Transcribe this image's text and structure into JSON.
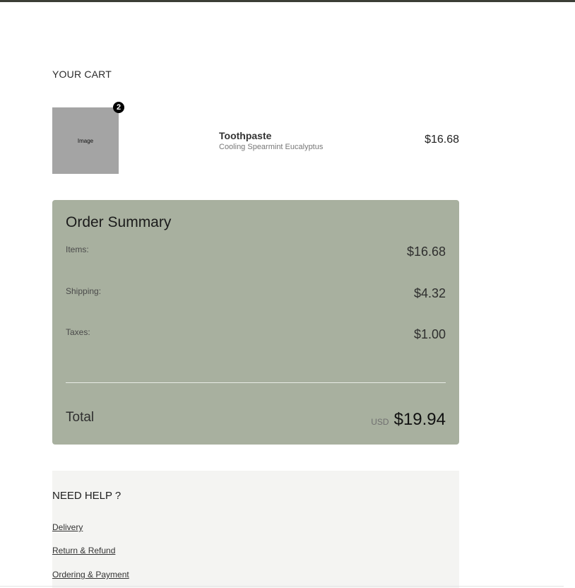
{
  "cart": {
    "title": "YOUR CART",
    "item": {
      "image_placeholder": "Image",
      "quantity_badge": "2",
      "name": "Toothpaste",
      "variant": "Cooling Spearmint Eucalyptus",
      "price": "$16.68"
    }
  },
  "summary": {
    "title": "Order Summary",
    "rows": [
      {
        "label": "Items:",
        "value": "$16.68"
      },
      {
        "label": "Shipping:",
        "value": "$4.32"
      },
      {
        "label": "Taxes:",
        "value": "$1.00"
      }
    ],
    "total_label": "Total",
    "currency": "USD",
    "total_value": "$19.94"
  },
  "help": {
    "title": "NEED HELP ?",
    "links": [
      "Delivery",
      "Return & Refund",
      "Ordering & Payment"
    ]
  },
  "colors": {
    "top_bar": "#3b3e36",
    "summary_bg": "#a8b09f",
    "help_bg": "#f4f4f2",
    "image_placeholder": "#a4a4a4"
  }
}
